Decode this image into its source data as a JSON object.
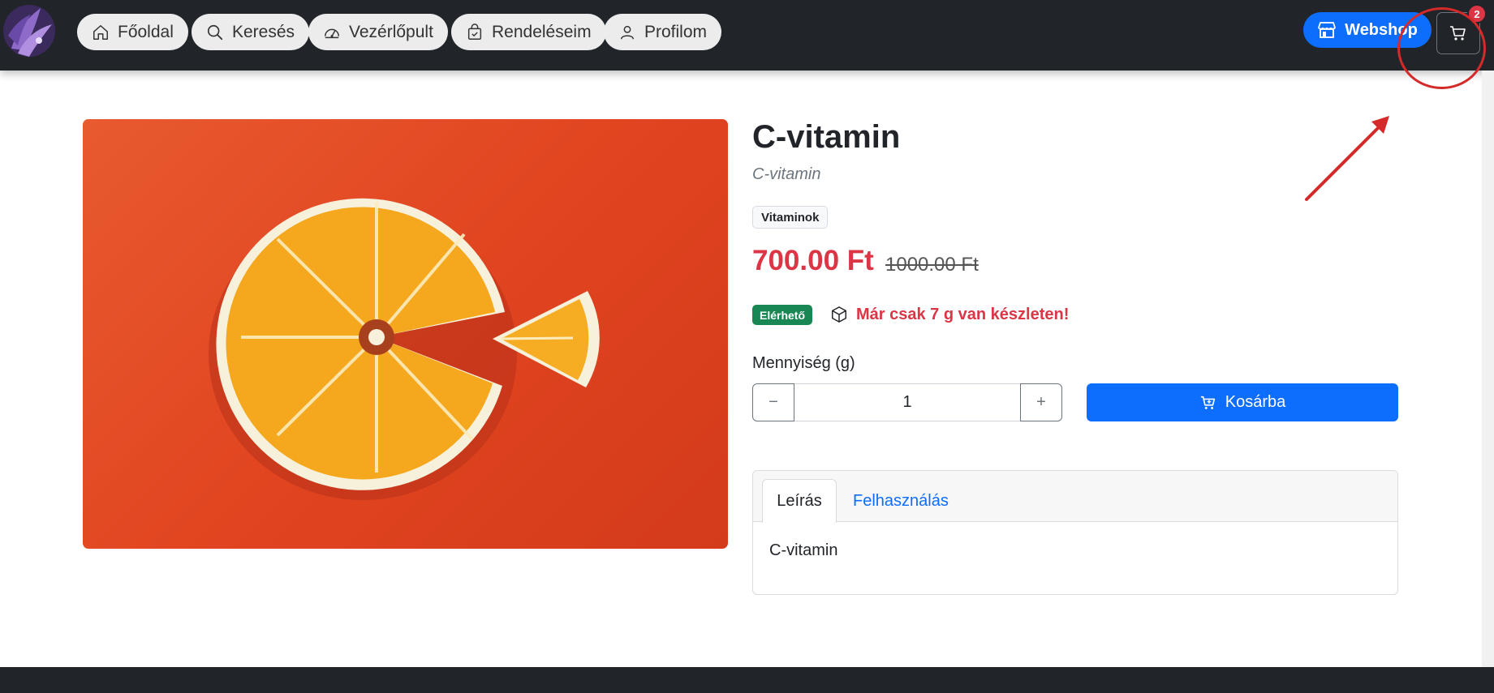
{
  "nav": {
    "items": [
      {
        "label": "Főoldal",
        "icon": "home-icon"
      },
      {
        "label": "Keresés",
        "icon": "search-icon"
      },
      {
        "label": "Vezérlőpult",
        "icon": "speedometer-icon"
      },
      {
        "label": "Rendeléseim",
        "icon": "bag-check-icon"
      },
      {
        "label": "Profilom",
        "icon": "person-icon"
      }
    ],
    "webshop_label": "Webshop",
    "cart_count": "2"
  },
  "product": {
    "title": "C-vitamin",
    "subtitle": "C-vitamin",
    "category": "Vitaminok",
    "price": "700.00 Ft",
    "old_price": "1000.00 Ft",
    "availability": "Elérhető",
    "stock_warning": "Már csak 7 g van készleten!",
    "quantity_label": "Mennyiség (g)",
    "quantity_value": "1",
    "minus_label": "−",
    "plus_label": "+",
    "add_to_cart_label": "Kosárba"
  },
  "tabs": {
    "items": [
      {
        "label": "Leírás",
        "active": true
      },
      {
        "label": "Felhasználás",
        "active": false
      }
    ],
    "content": "C-vitamin"
  },
  "colors": {
    "navbar": "#212529",
    "primary": "#0d6efd",
    "danger": "#dc3545",
    "success": "#198754"
  }
}
